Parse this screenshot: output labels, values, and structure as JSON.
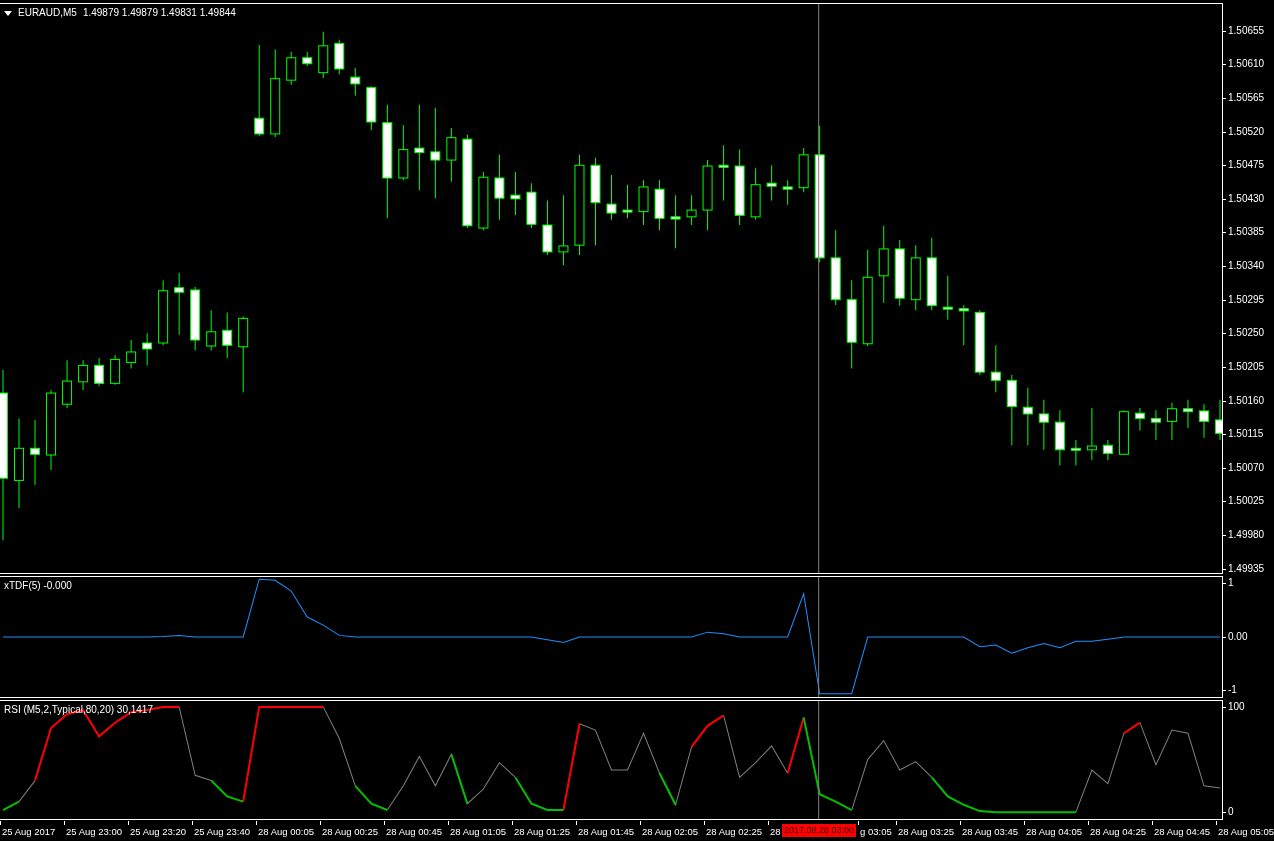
{
  "header": {
    "symbol": "EURAUD,M5",
    "quotes": "1.49879 1.49879 1.49831 1.49844"
  },
  "price_chart": {
    "chart_data": {
      "type": "candlestick",
      "ylim": [
        1.49929,
        1.50691
      ],
      "ohlc": [
        [
          1.5017,
          1.50201,
          1.49973,
          1.50056
        ],
        [
          1.50053,
          1.50136,
          1.50016,
          1.50096
        ],
        [
          1.50096,
          1.50134,
          1.50047,
          1.50088
        ],
        [
          1.50087,
          1.50174,
          1.50067,
          1.5017
        ],
        [
          1.50155,
          1.50214,
          1.5015,
          1.50186
        ],
        [
          1.50185,
          1.50214,
          1.50174,
          1.50207
        ],
        [
          1.50207,
          1.50217,
          1.50179,
          1.50183
        ],
        [
          1.50183,
          1.50221,
          1.50181,
          1.50215
        ],
        [
          1.50211,
          1.50241,
          1.50203,
          1.50225
        ],
        [
          1.50237,
          1.5025,
          1.50207,
          1.50229
        ],
        [
          1.50237,
          1.50321,
          1.50234,
          1.50307
        ],
        [
          1.50311,
          1.50331,
          1.50248,
          1.50305
        ],
        [
          1.50308,
          1.50312,
          1.50227,
          1.50241
        ],
        [
          1.50233,
          1.50281,
          1.50227,
          1.50252
        ],
        [
          1.50254,
          1.50278,
          1.50217,
          1.50234
        ],
        [
          1.50232,
          1.50273,
          1.50171,
          1.5027
        ],
        [
          1.50538,
          1.50636,
          1.50514,
          1.50517
        ],
        [
          1.50517,
          1.5063,
          1.50513,
          1.50591
        ],
        [
          1.50589,
          1.50627,
          1.50583,
          1.50619
        ],
        [
          1.50619,
          1.50627,
          1.50608,
          1.50611
        ],
        [
          1.50599,
          1.50654,
          1.50592,
          1.50635
        ],
        [
          1.50638,
          1.50643,
          1.50597,
          1.50604
        ],
        [
          1.50593,
          1.50605,
          1.50568,
          1.50584
        ],
        [
          1.50579,
          1.50581,
          1.50522,
          1.50533
        ],
        [
          1.50532,
          1.50556,
          1.50404,
          1.50458
        ],
        [
          1.50458,
          1.50529,
          1.50455,
          1.50496
        ],
        [
          1.50498,
          1.50556,
          1.50442,
          1.50492
        ],
        [
          1.50493,
          1.50552,
          1.50431,
          1.50482
        ],
        [
          1.50482,
          1.50525,
          1.50453,
          1.50512
        ],
        [
          1.5051,
          1.50516,
          1.50391,
          1.50394
        ],
        [
          1.50391,
          1.50466,
          1.50388,
          1.50459
        ],
        [
          1.50458,
          1.50489,
          1.50402,
          1.50431
        ],
        [
          1.50435,
          1.50466,
          1.50408,
          1.5043
        ],
        [
          1.50439,
          1.50451,
          1.50391,
          1.50396
        ],
        [
          1.50395,
          1.50428,
          1.50355,
          1.50359
        ],
        [
          1.50359,
          1.50435,
          1.50341,
          1.50367
        ],
        [
          1.50368,
          1.50489,
          1.50355,
          1.50475
        ],
        [
          1.50475,
          1.50485,
          1.50368,
          1.50425
        ],
        [
          1.50423,
          1.50462,
          1.50402,
          1.50411
        ],
        [
          1.50415,
          1.50449,
          1.50404,
          1.50413
        ],
        [
          1.50413,
          1.50455,
          1.50395,
          1.50446
        ],
        [
          1.50443,
          1.50455,
          1.50388,
          1.50404
        ],
        [
          1.50406,
          1.50435,
          1.50364,
          1.50403
        ],
        [
          1.50406,
          1.50435,
          1.50395,
          1.50415
        ],
        [
          1.50415,
          1.50482,
          1.50388,
          1.50474
        ],
        [
          1.50475,
          1.50502,
          1.50428,
          1.50473
        ],
        [
          1.50474,
          1.50496,
          1.50395,
          1.50408
        ],
        [
          1.50406,
          1.50471,
          1.50402,
          1.50449
        ],
        [
          1.50451,
          1.50475,
          1.50428,
          1.50447
        ],
        [
          1.50446,
          1.50455,
          1.50422,
          1.50443
        ],
        [
          1.50445,
          1.50498,
          1.50439,
          1.50489
        ],
        [
          1.50489,
          1.50528,
          1.50345,
          1.50351
        ],
        [
          1.50351,
          1.50388,
          1.50288,
          1.50295
        ],
        [
          1.50295,
          1.50321,
          1.50203,
          1.50238
        ],
        [
          1.50236,
          1.50362,
          1.50233,
          1.50325
        ],
        [
          1.50327,
          1.50394,
          1.50291,
          1.50363
        ],
        [
          1.50363,
          1.50375,
          1.50287,
          1.50297
        ],
        [
          1.50295,
          1.50368,
          1.50281,
          1.50351
        ],
        [
          1.50351,
          1.50378,
          1.50281,
          1.50287
        ],
        [
          1.50285,
          1.50327,
          1.50268,
          1.50283
        ],
        [
          1.50283,
          1.50288,
          1.50234,
          1.5028
        ],
        [
          1.50278,
          1.50281,
          1.50194,
          1.50198
        ],
        [
          1.50198,
          1.50234,
          1.50171,
          1.50187
        ],
        [
          1.50187,
          1.50194,
          1.501,
          1.50152
        ],
        [
          1.50151,
          1.50177,
          1.501,
          1.50142
        ],
        [
          1.50142,
          1.50161,
          1.50094,
          1.50131
        ],
        [
          1.50131,
          1.50147,
          1.50073,
          1.50094
        ],
        [
          1.50096,
          1.50107,
          1.50073,
          1.50094
        ],
        [
          1.50094,
          1.5015,
          1.5008,
          1.50099
        ],
        [
          1.501,
          1.50107,
          1.5008,
          1.50089
        ],
        [
          1.50088,
          1.50147,
          1.50087,
          1.50145
        ],
        [
          1.50143,
          1.5015,
          1.5012,
          1.50136
        ],
        [
          1.50136,
          1.50147,
          1.50107,
          1.50131
        ],
        [
          1.50132,
          1.50157,
          1.50107,
          1.50149
        ],
        [
          1.50149,
          1.50161,
          1.50123,
          1.50145
        ],
        [
          1.50146,
          1.50155,
          1.5011,
          1.50132
        ],
        [
          1.50134,
          1.50161,
          1.50107,
          1.50116
        ]
      ],
      "yticks": [
        {
          "value": 1.50655,
          "label": "1.50655"
        },
        {
          "value": 1.5061,
          "label": "1.50610"
        },
        {
          "value": 1.50565,
          "label": "1.50565"
        },
        {
          "value": 1.5052,
          "label": "1.50520"
        },
        {
          "value": 1.50475,
          "label": "1.50475"
        },
        {
          "value": 1.5043,
          "label": "1.50430"
        },
        {
          "value": 1.50385,
          "label": "1.50385"
        },
        {
          "value": 1.5034,
          "label": "1.50340"
        },
        {
          "value": 1.50295,
          "label": "1.50295"
        },
        {
          "value": 1.5025,
          "label": "1.50250"
        },
        {
          "value": 1.50205,
          "label": "1.50205"
        },
        {
          "value": 1.5016,
          "label": "1.50160"
        },
        {
          "value": 1.50115,
          "label": "1.50115"
        },
        {
          "value": 1.5007,
          "label": "1.50070"
        },
        {
          "value": 1.50025,
          "label": "1.50025"
        },
        {
          "value": 1.4998,
          "label": "1.49980"
        },
        {
          "value": 1.49935,
          "label": "1.49935"
        }
      ]
    }
  },
  "indicators": [
    {
      "kind": "tdf",
      "chart_data": {
        "type": "line",
        "title": "xTDF(5) -0.000",
        "ylim": [
          -1.11,
          1.11
        ],
        "yticks": [
          {
            "value": 1,
            "label": "1"
          },
          {
            "value": 0,
            "label": "0.00"
          },
          {
            "value": -1,
            "label": "-1"
          }
        ],
        "series": [
          {
            "color": "#1e90ff",
            "values": [
              0,
              0,
              0,
              0,
              0,
              0,
              0,
              0,
              0,
              0,
              0.01,
              0.03,
              0,
              0,
              0,
              0,
              1.07,
              1.05,
              0.85,
              0.37,
              0.22,
              0.03,
              0,
              0,
              0,
              0,
              0,
              0,
              0,
              0,
              0,
              0,
              0,
              0,
              -0.05,
              -0.1,
              0,
              0,
              0,
              0,
              0,
              0,
              0,
              0,
              0.09,
              0.06,
              0,
              0,
              0,
              0,
              0.8,
              -1.05,
              -1.05,
              -1.05,
              0,
              0,
              0,
              0,
              0,
              0,
              0,
              -0.18,
              -0.15,
              -0.3,
              -0.2,
              -0.12,
              -0.2,
              -0.08,
              -0.08,
              -0.04,
              0,
              0,
              0,
              0,
              0,
              0,
              0
            ]
          }
        ]
      }
    },
    {
      "kind": "rsi",
      "chart_data": {
        "type": "line",
        "title": "RSI (M5,2,Typical,80,20) 30,1417",
        "ylim": [
          -6.5,
          105.6
        ],
        "yticks": [
          {
            "value": 100,
            "label": "100"
          },
          {
            "value": 0,
            "label": "0"
          }
        ],
        "series": [
          {
            "color": "#808080",
            "values": [
              null,
              10,
              30,
              null,
              null,
              null,
              null,
              null,
              null,
              null,
              null,
              100,
              35,
              30,
              null,
              null,
              null,
              null,
              null,
              null,
              100,
              70,
              25,
              null,
              2,
              25,
              53,
              25,
              55,
              8,
              22,
              47,
              33,
              null,
              null,
              null,
              84,
              78,
              40,
              40,
              75,
              37,
              7,
              62,
              null,
              92,
              33,
              47,
              63,
              37,
              null,
              null,
              null,
              2,
              50,
              68,
              40,
              48,
              33,
              null,
              null,
              null,
              null,
              null,
              null,
              null,
              null,
              0,
              40,
              27,
              75,
              85,
              45,
              78,
              75,
              25,
              23
            ]
          },
          {
            "color": "#ff0000",
            "values": [
              null,
              null,
              30,
              80,
              93,
              97,
              72,
              85,
              95,
              97,
              100,
              100,
              null,
              null,
              null,
              10,
              100,
              100,
              100,
              100,
              100,
              null,
              null,
              null,
              null,
              null,
              null,
              null,
              null,
              null,
              null,
              null,
              null,
              null,
              null,
              2,
              84,
              null,
              null,
              null,
              null,
              null,
              null,
              62,
              82,
              92,
              null,
              null,
              null,
              37,
              90,
              null,
              null,
              null,
              null,
              null,
              null,
              null,
              null,
              null,
              null,
              null,
              null,
              null,
              null,
              null,
              null,
              null,
              null,
              null,
              75,
              85,
              null,
              null,
              null,
              null,
              null
            ]
          },
          {
            "color": "#00c000",
            "values": [
              2,
              10,
              null,
              null,
              null,
              null,
              null,
              null,
              null,
              null,
              null,
              null,
              null,
              30,
              15,
              10,
              null,
              null,
              null,
              null,
              null,
              null,
              25,
              8,
              2,
              null,
              null,
              null,
              55,
              8,
              null,
              null,
              33,
              8,
              2,
              2,
              null,
              null,
              null,
              null,
              null,
              37,
              7,
              null,
              null,
              null,
              null,
              null,
              null,
              null,
              90,
              17,
              10,
              2,
              null,
              null,
              null,
              null,
              33,
              15,
              7,
              1,
              0,
              0,
              0,
              0,
              0,
              0,
              null,
              null,
              null,
              null,
              null,
              null,
              null,
              null,
              null
            ]
          }
        ]
      }
    }
  ],
  "time_axis": [
    {
      "label": "25 Aug 2017",
      "kind": "full"
    },
    {
      "label": "25 Aug 23:00",
      "kind": "full"
    },
    {
      "label": "25 Aug 23:20",
      "kind": "full"
    },
    {
      "label": "25 Aug 23:40",
      "kind": "full"
    },
    {
      "label": "28 Aug 00:05",
      "kind": "full"
    },
    {
      "label": "28 Aug 00:25",
      "kind": "full"
    },
    {
      "label": "28 Aug 00:45",
      "kind": "full"
    },
    {
      "label": "28 Aug 01:05",
      "kind": "full"
    },
    {
      "label": "28 Aug 01:25",
      "kind": "full"
    },
    {
      "label": "28 Aug 01:45",
      "kind": "full"
    },
    {
      "label": "28 Aug 02:05",
      "kind": "full"
    },
    {
      "label": "28 Aug 02:25",
      "kind": "full"
    },
    {
      "label": "28",
      "kind": "full"
    },
    {
      "label": "g 03:05",
      "kind": "cut_left"
    },
    {
      "label": "28 Aug 03:25",
      "kind": "full"
    },
    {
      "label": "28 Aug 03:45",
      "kind": "full"
    },
    {
      "label": "28 Aug 04:05",
      "kind": "full"
    },
    {
      "label": "28 Aug 04:25",
      "kind": "full"
    },
    {
      "label": "28 Aug 04:45",
      "kind": "full"
    },
    {
      "label": "28 Aug 05:05",
      "kind": "full"
    }
  ],
  "crosshair": {
    "time": "2017.08.28 03:00"
  }
}
